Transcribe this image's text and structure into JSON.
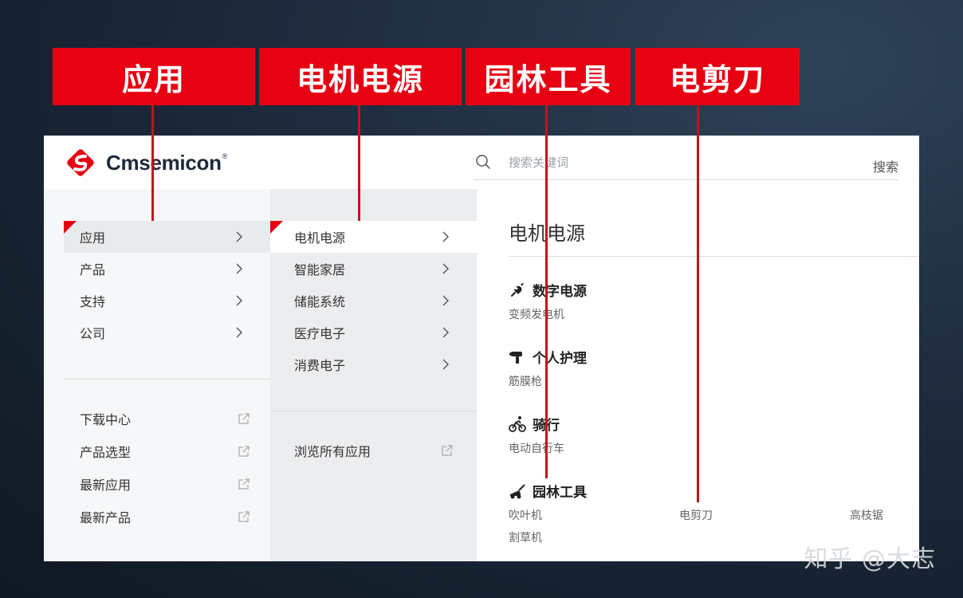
{
  "crumbs": [
    "应用",
    "电机电源",
    "园林工具",
    "电剪刀"
  ],
  "brand": {
    "name": "Cmsemicon",
    "trademark": "®",
    "color": "#e60012"
  },
  "search": {
    "placeholder": "搜索关键词",
    "button": "搜索"
  },
  "primary_menu": [
    {
      "label": "应用",
      "active": true
    },
    {
      "label": "产品"
    },
    {
      "label": "支持"
    },
    {
      "label": "公司"
    }
  ],
  "primary_links": [
    "下载中心",
    "产品选型",
    "最新应用",
    "最新产品"
  ],
  "secondary_menu": [
    {
      "label": "电机电源",
      "active": true
    },
    {
      "label": "智能家居"
    },
    {
      "label": "储能系统"
    },
    {
      "label": "医疗电子"
    },
    {
      "label": "消费电子"
    }
  ],
  "secondary_link": "浏览所有应用",
  "detail": {
    "title": "电机电源",
    "categories": [
      {
        "name": "数字电源",
        "icon": "plug-icon",
        "items": [
          "变频发电机"
        ]
      },
      {
        "name": "个人护理",
        "icon": "massage-gun-icon",
        "items": [
          "筋膜枪"
        ]
      },
      {
        "name": "骑行",
        "icon": "cyclist-icon",
        "items": [
          "电动自行车"
        ]
      },
      {
        "name": "园林工具",
        "icon": "lawn-mower-icon",
        "items": [
          "吹叶机",
          "电剪刀",
          "高枝锯",
          "割草机"
        ]
      }
    ]
  },
  "watermark": "知乎 @大志"
}
